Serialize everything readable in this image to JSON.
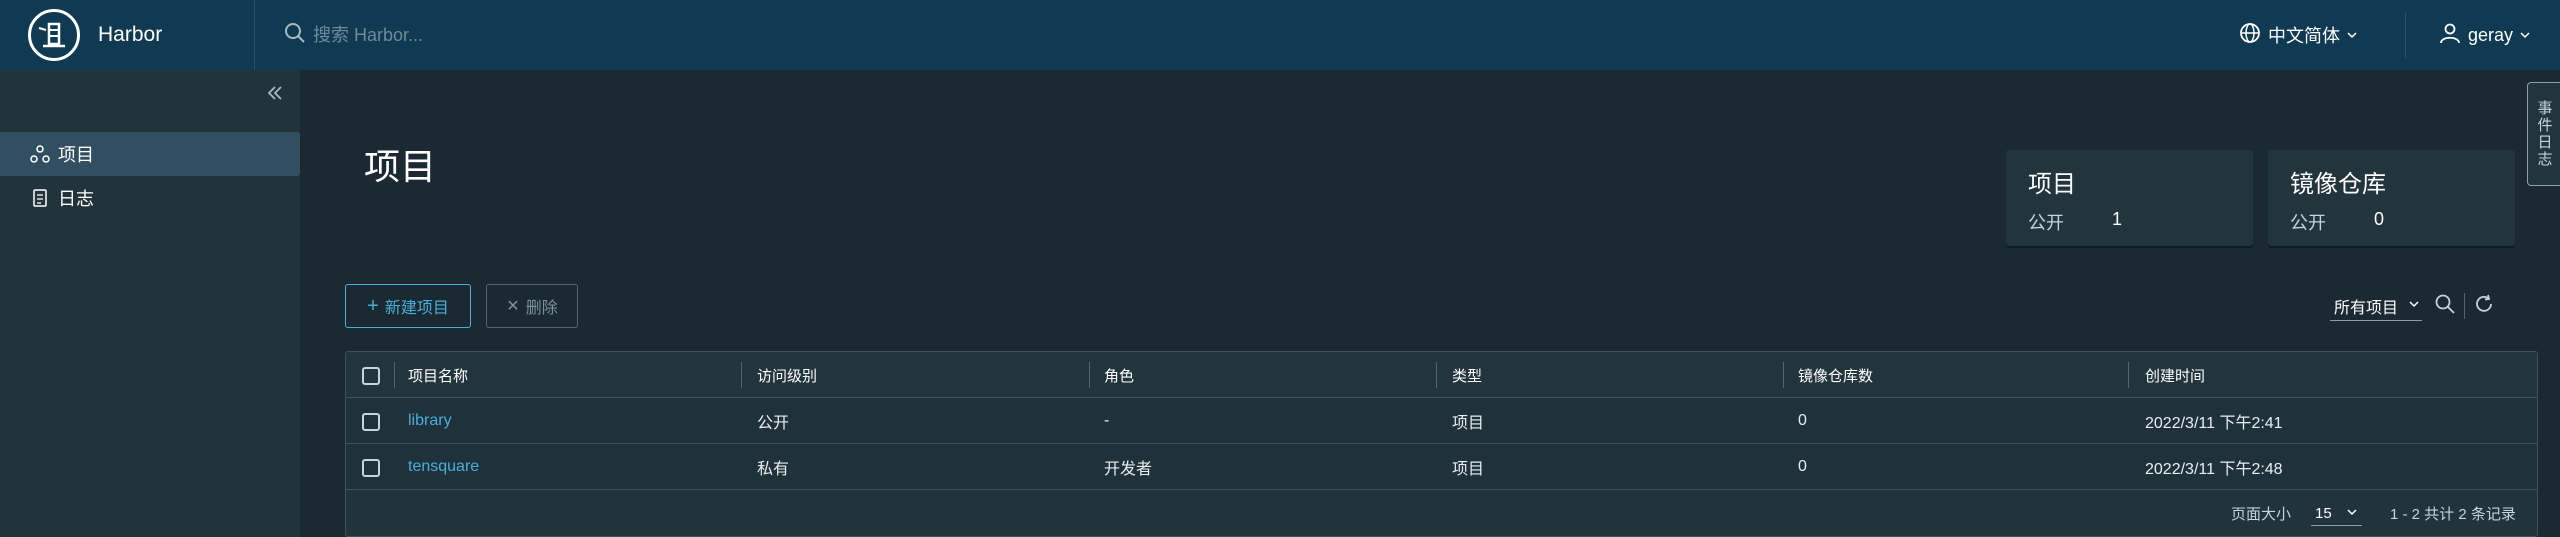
{
  "app": {
    "name": "Harbor"
  },
  "search": {
    "placeholder": "搜索 Harbor..."
  },
  "header": {
    "language": "中文简体",
    "user": "geray"
  },
  "sidebar": {
    "items": [
      {
        "label": "项目",
        "icon": "projects-icon",
        "active": true
      },
      {
        "label": "日志",
        "icon": "logs-icon",
        "active": false
      }
    ]
  },
  "main": {
    "title": "项目",
    "cards": [
      {
        "title": "项目",
        "label": "公开",
        "value": "1"
      },
      {
        "title": "镜像仓库",
        "label": "公开",
        "value": "0"
      }
    ],
    "new_button": "新建项目",
    "delete_button": "删除",
    "filter_label": "所有项目",
    "side_tab": "事件日志"
  },
  "table": {
    "columns": [
      "项目名称",
      "访问级别",
      "角色",
      "类型",
      "镜像仓库数",
      "创建时间"
    ],
    "rows": [
      {
        "name": "library",
        "access": "公开",
        "role": "-",
        "type": "项目",
        "repos": "0",
        "created": "2022/3/11 下午2:41"
      },
      {
        "name": "tensquare",
        "access": "私有",
        "role": "开发者",
        "type": "项目",
        "repos": "0",
        "created": "2022/3/11 下午2:48"
      }
    ],
    "footer": {
      "page_size_label": "页面大小",
      "page_size": "15",
      "summary": "1 - 2 共计 2 条记录"
    }
  },
  "colors": {
    "header": "#0f3a52",
    "accent": "#4aaed9",
    "background": "#1b2a32",
    "sidebar": "#21333b"
  }
}
